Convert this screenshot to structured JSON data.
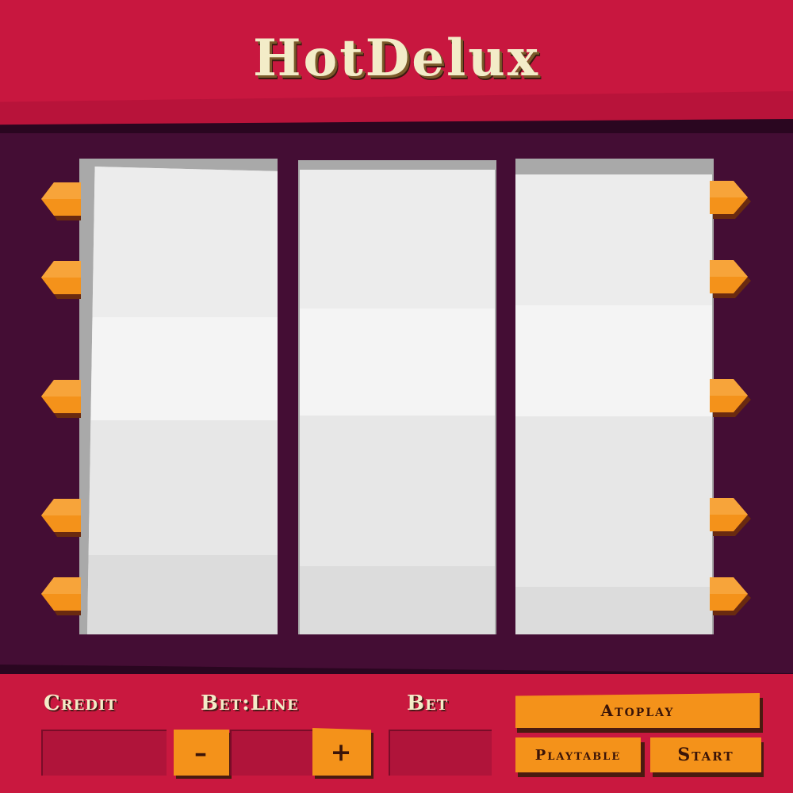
{
  "title": "HotDelux",
  "labels": {
    "credit": "Credit",
    "bet_line": "Bet:Line",
    "bet": "Bet"
  },
  "buttons": {
    "minus": "–",
    "plus": "+",
    "autoplay": "Atoplay",
    "playtable": "Playtable",
    "start": "Start"
  },
  "colors": {
    "header": "#c8173f",
    "reel_background": "#440d34",
    "reel": "#e9e9e9",
    "marker": "#f4921a",
    "title_text": "#f3ecc8"
  },
  "reels": [
    {
      "name": "reel-1",
      "symbols": []
    },
    {
      "name": "reel-2",
      "symbols": []
    },
    {
      "name": "reel-3",
      "symbols": []
    }
  ],
  "paylines": {
    "left_count": 5,
    "right_count": 5
  }
}
